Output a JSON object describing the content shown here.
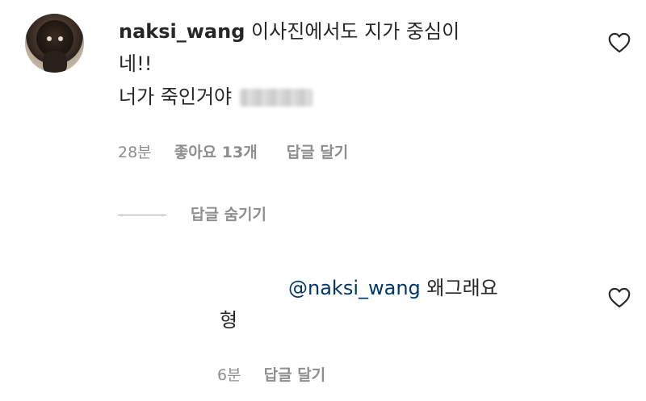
{
  "comment": {
    "username": "naksi_wang",
    "text_line1": "이사진에서도 지가 중심이",
    "text_line2": "네!!",
    "text_line3": "너가 죽인거야",
    "time": "28분",
    "likes": "좋아요 13개",
    "reply_label": "답글 달기"
  },
  "replies_toggle": {
    "label": "답글 숨기기"
  },
  "reply": {
    "mention": "@naksi_wang",
    "text_line1": "왜그래요",
    "text_line2": "형",
    "time": "6분",
    "reply_label": "답글 달기"
  },
  "icons": {
    "like": "heart-icon",
    "avatar": "avatar-image"
  },
  "colors": {
    "text": "#262626",
    "muted": "#8e8e8e",
    "mention": "#00376b"
  }
}
